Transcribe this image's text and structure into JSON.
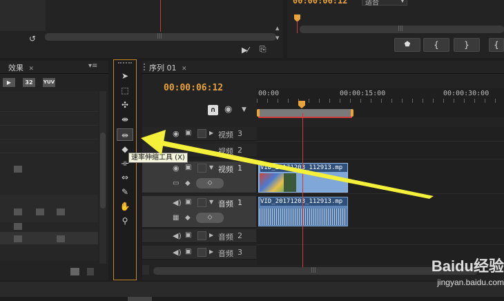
{
  "top_right": {
    "timecode": "00:00:06:12",
    "fit_dropdown": "适合",
    "controls": [
      "mark-in",
      "step-back",
      "step-forward",
      "mark-out"
    ]
  },
  "effects_panel": {
    "tab_label": "效果",
    "badges": [
      "32",
      "YUV"
    ]
  },
  "tooltip": {
    "text": "速率伸缩工具 (X)"
  },
  "sequence": {
    "tab_label": "序列 01",
    "timecode": "00:00:06:12",
    "ruler": [
      "00:00",
      "00:00:15:00",
      "00:00:30:00"
    ],
    "tracks": [
      {
        "label": "视频",
        "num": "3",
        "type": "video"
      },
      {
        "label": "视频",
        "num": "2",
        "type": "video"
      },
      {
        "label": "视频",
        "num": "1",
        "type": "video"
      },
      {
        "label": "音频",
        "num": "1",
        "type": "audio"
      },
      {
        "label": "音频",
        "num": "2",
        "type": "audio"
      },
      {
        "label": "音频",
        "num": "3",
        "type": "audio"
      }
    ],
    "clips": {
      "video": "VID_20171203_112913.mp",
      "audio": "VID_20171203_112913.mp"
    }
  },
  "watermark": {
    "brand": "Baidu经验",
    "url": "jingyan.baidu.com"
  },
  "colors": {
    "accent": "#e8a33a",
    "playhead": "#d03a3a",
    "arrow": "#f5f03a",
    "video_clip": "#7fa8d8",
    "audio_clip": "#5e86b8"
  }
}
